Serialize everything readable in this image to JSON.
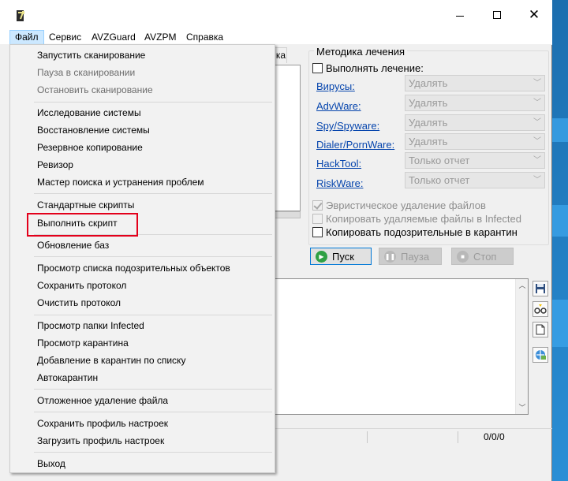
{
  "menubar": {
    "items": [
      "Файл",
      "Сервис",
      "AVZGuard",
      "AVZPM",
      "Справка"
    ]
  },
  "file_menu": {
    "groups": [
      [
        {
          "label": "Запустить сканирование",
          "enabled": true
        },
        {
          "label": "Пауза в сканировании",
          "enabled": false
        },
        {
          "label": "Остановить сканирование",
          "enabled": false
        }
      ],
      [
        {
          "label": "Исследование системы",
          "enabled": true
        },
        {
          "label": "Восстановление системы",
          "enabled": true
        },
        {
          "label": "Резервное копирование",
          "enabled": true
        },
        {
          "label": "Ревизор",
          "enabled": true
        },
        {
          "label": "Мастер поиска и устранения проблем",
          "enabled": true
        }
      ],
      [
        {
          "label": "Стандартные скрипты",
          "enabled": true
        },
        {
          "label": "Выполнить скрипт",
          "enabled": true,
          "highlighted": true
        }
      ],
      [
        {
          "label": "Обновление баз",
          "enabled": true
        }
      ],
      [
        {
          "label": "Просмотр списка подозрительных объектов",
          "enabled": true
        },
        {
          "label": "Сохранить протокол",
          "enabled": true
        },
        {
          "label": "Очистить протокол",
          "enabled": true
        }
      ],
      [
        {
          "label": "Просмотр папки Infected",
          "enabled": true
        },
        {
          "label": "Просмотр карантина",
          "enabled": true
        },
        {
          "label": "Добавление в карантин по списку",
          "enabled": true
        },
        {
          "label": "Автокарантин",
          "enabled": true
        }
      ],
      [
        {
          "label": "Отложенное удаление файла",
          "enabled": true
        }
      ],
      [
        {
          "label": "Сохранить профиль настроек",
          "enabled": true
        },
        {
          "label": "Загрузить профиль настроек",
          "enabled": true
        }
      ],
      [
        {
          "label": "Выход",
          "enabled": true
        }
      ]
    ]
  },
  "tab_fragment": "ка",
  "treatment": {
    "title": "Методика лечения",
    "perform_treatment": {
      "label": "Выполнять лечение:",
      "checked": false
    },
    "threats": [
      {
        "name": "Вирусы:",
        "action": "Удалять"
      },
      {
        "name": "AdvWare:",
        "action": "Удалять"
      },
      {
        "name": "Spy/Spyware:",
        "action": "Удалять"
      },
      {
        "name": "Dialer/PornWare:",
        "action": "Удалять"
      },
      {
        "name": "HackTool:",
        "action": "Только отчет"
      },
      {
        "name": "RiskWare:",
        "action": "Только отчет"
      }
    ],
    "options": [
      {
        "label": "Эвристическое удаление файлов",
        "checked": true,
        "enabled": false
      },
      {
        "label": "Копировать удаляемые файлы в  Infected",
        "checked": false,
        "enabled": false
      },
      {
        "label": "Копировать подозрительные в  карантин",
        "checked": false,
        "enabled": true
      }
    ]
  },
  "buttons": {
    "start": "Пуск",
    "pause": "Пауза",
    "stop": "Стоп"
  },
  "status": {
    "counter": "0/0/0"
  },
  "side_icons": [
    "save-icon",
    "glasses-icon",
    "document-icon",
    "network-icon"
  ],
  "colors": {
    "highlight_border": "#e3001b",
    "link": "#0645ad",
    "menubar_active": "#cce8ff",
    "start_icon": "#2ea043"
  }
}
